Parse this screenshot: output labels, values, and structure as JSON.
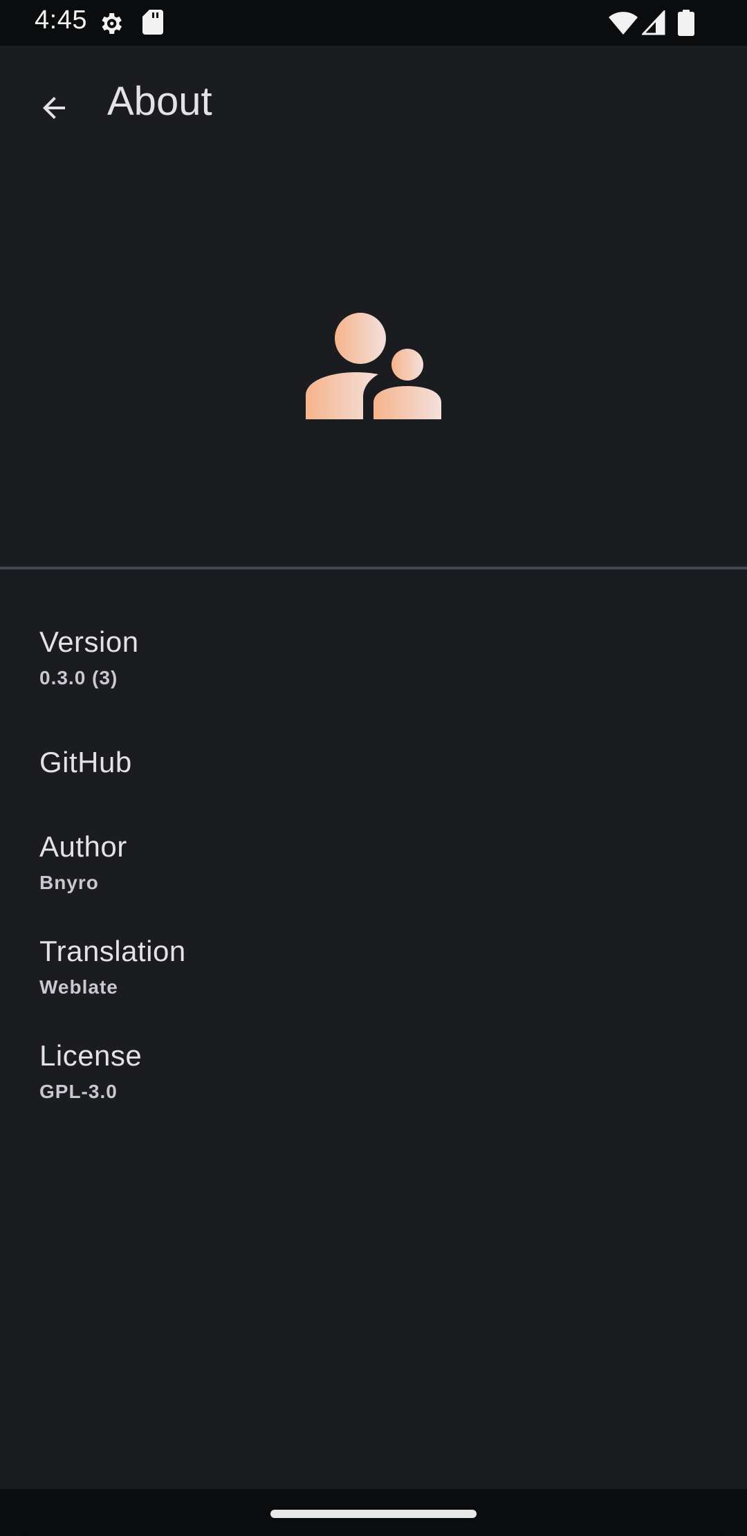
{
  "status_bar": {
    "time": "4:45",
    "icons": [
      "settings-icon",
      "sd-card-icon",
      "wifi-icon",
      "signal-icon",
      "battery-icon"
    ]
  },
  "top_bar": {
    "back_icon": "arrow-back-icon",
    "title": "About"
  },
  "hero": {
    "icon": "people-icon",
    "gradient": [
      "#f6b48c",
      "#f3e0dc"
    ]
  },
  "list": [
    {
      "title": "Version",
      "subtitle": "0.3.0 (3)"
    },
    {
      "title": "GitHub",
      "subtitle": ""
    },
    {
      "title": "Author",
      "subtitle": "Bnyro"
    },
    {
      "title": "Translation",
      "subtitle": "Weblate"
    },
    {
      "title": "License",
      "subtitle": "GPL-3.0"
    }
  ],
  "colors": {
    "background": "#1a1c1f",
    "on_surface": "#e4e2e6",
    "divider": "#45464f"
  }
}
